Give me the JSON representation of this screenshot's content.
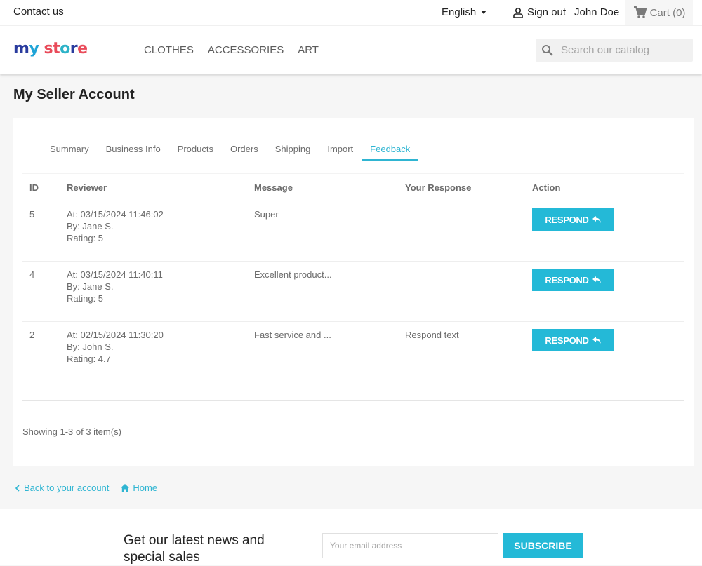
{
  "topbar": {
    "contact_label": "Contact us",
    "language": "English",
    "signout_label": "Sign out",
    "user_name": "John Doe",
    "cart_label": "Cart (0)"
  },
  "header": {
    "logo": {
      "m": "m",
      "y": "y",
      "sp": " ",
      "s": "s",
      "t": "t",
      "o": "o",
      "r": "r",
      "e": "e"
    },
    "nav": [
      "CLOTHES",
      "ACCESSORIES",
      "ART"
    ],
    "search_placeholder": "Search our catalog"
  },
  "page": {
    "title": "My Seller Account",
    "tabs": [
      "Summary",
      "Business Info",
      "Products",
      "Orders",
      "Shipping",
      "Import",
      "Feedback"
    ],
    "active_tab": "Feedback",
    "accent_color": "#2fb5d2"
  },
  "table": {
    "headers": [
      "ID",
      "Reviewer",
      "Message",
      "Your Response",
      "Action"
    ],
    "rows": [
      {
        "id": "5",
        "at": "At: 03/15/2024 11:46:02",
        "by": "By: Jane S.",
        "rating": "Rating: 5",
        "message": "Super",
        "response": "",
        "action": "RESPOND"
      },
      {
        "id": "4",
        "at": "At: 03/15/2024 11:40:11",
        "by": "By: Jane S.",
        "rating": "Rating: 5",
        "message": "Excellent product...",
        "response": "",
        "action": "RESPOND"
      },
      {
        "id": "2",
        "at": "At: 02/15/2024 11:30:20",
        "by": "By: John S.",
        "rating": "Rating: 4.7",
        "message": "Fast service and ...",
        "response": "Respond text",
        "action": "RESPOND"
      }
    ],
    "showing": "Showing 1-3 of 3 item(s)"
  },
  "footer_links": {
    "back": "Back to your account",
    "home": "Home"
  },
  "newsletter": {
    "title": "Get our latest news and special sales",
    "email_placeholder": "Your email address",
    "subscribe_label": "SUBSCRIBE"
  }
}
